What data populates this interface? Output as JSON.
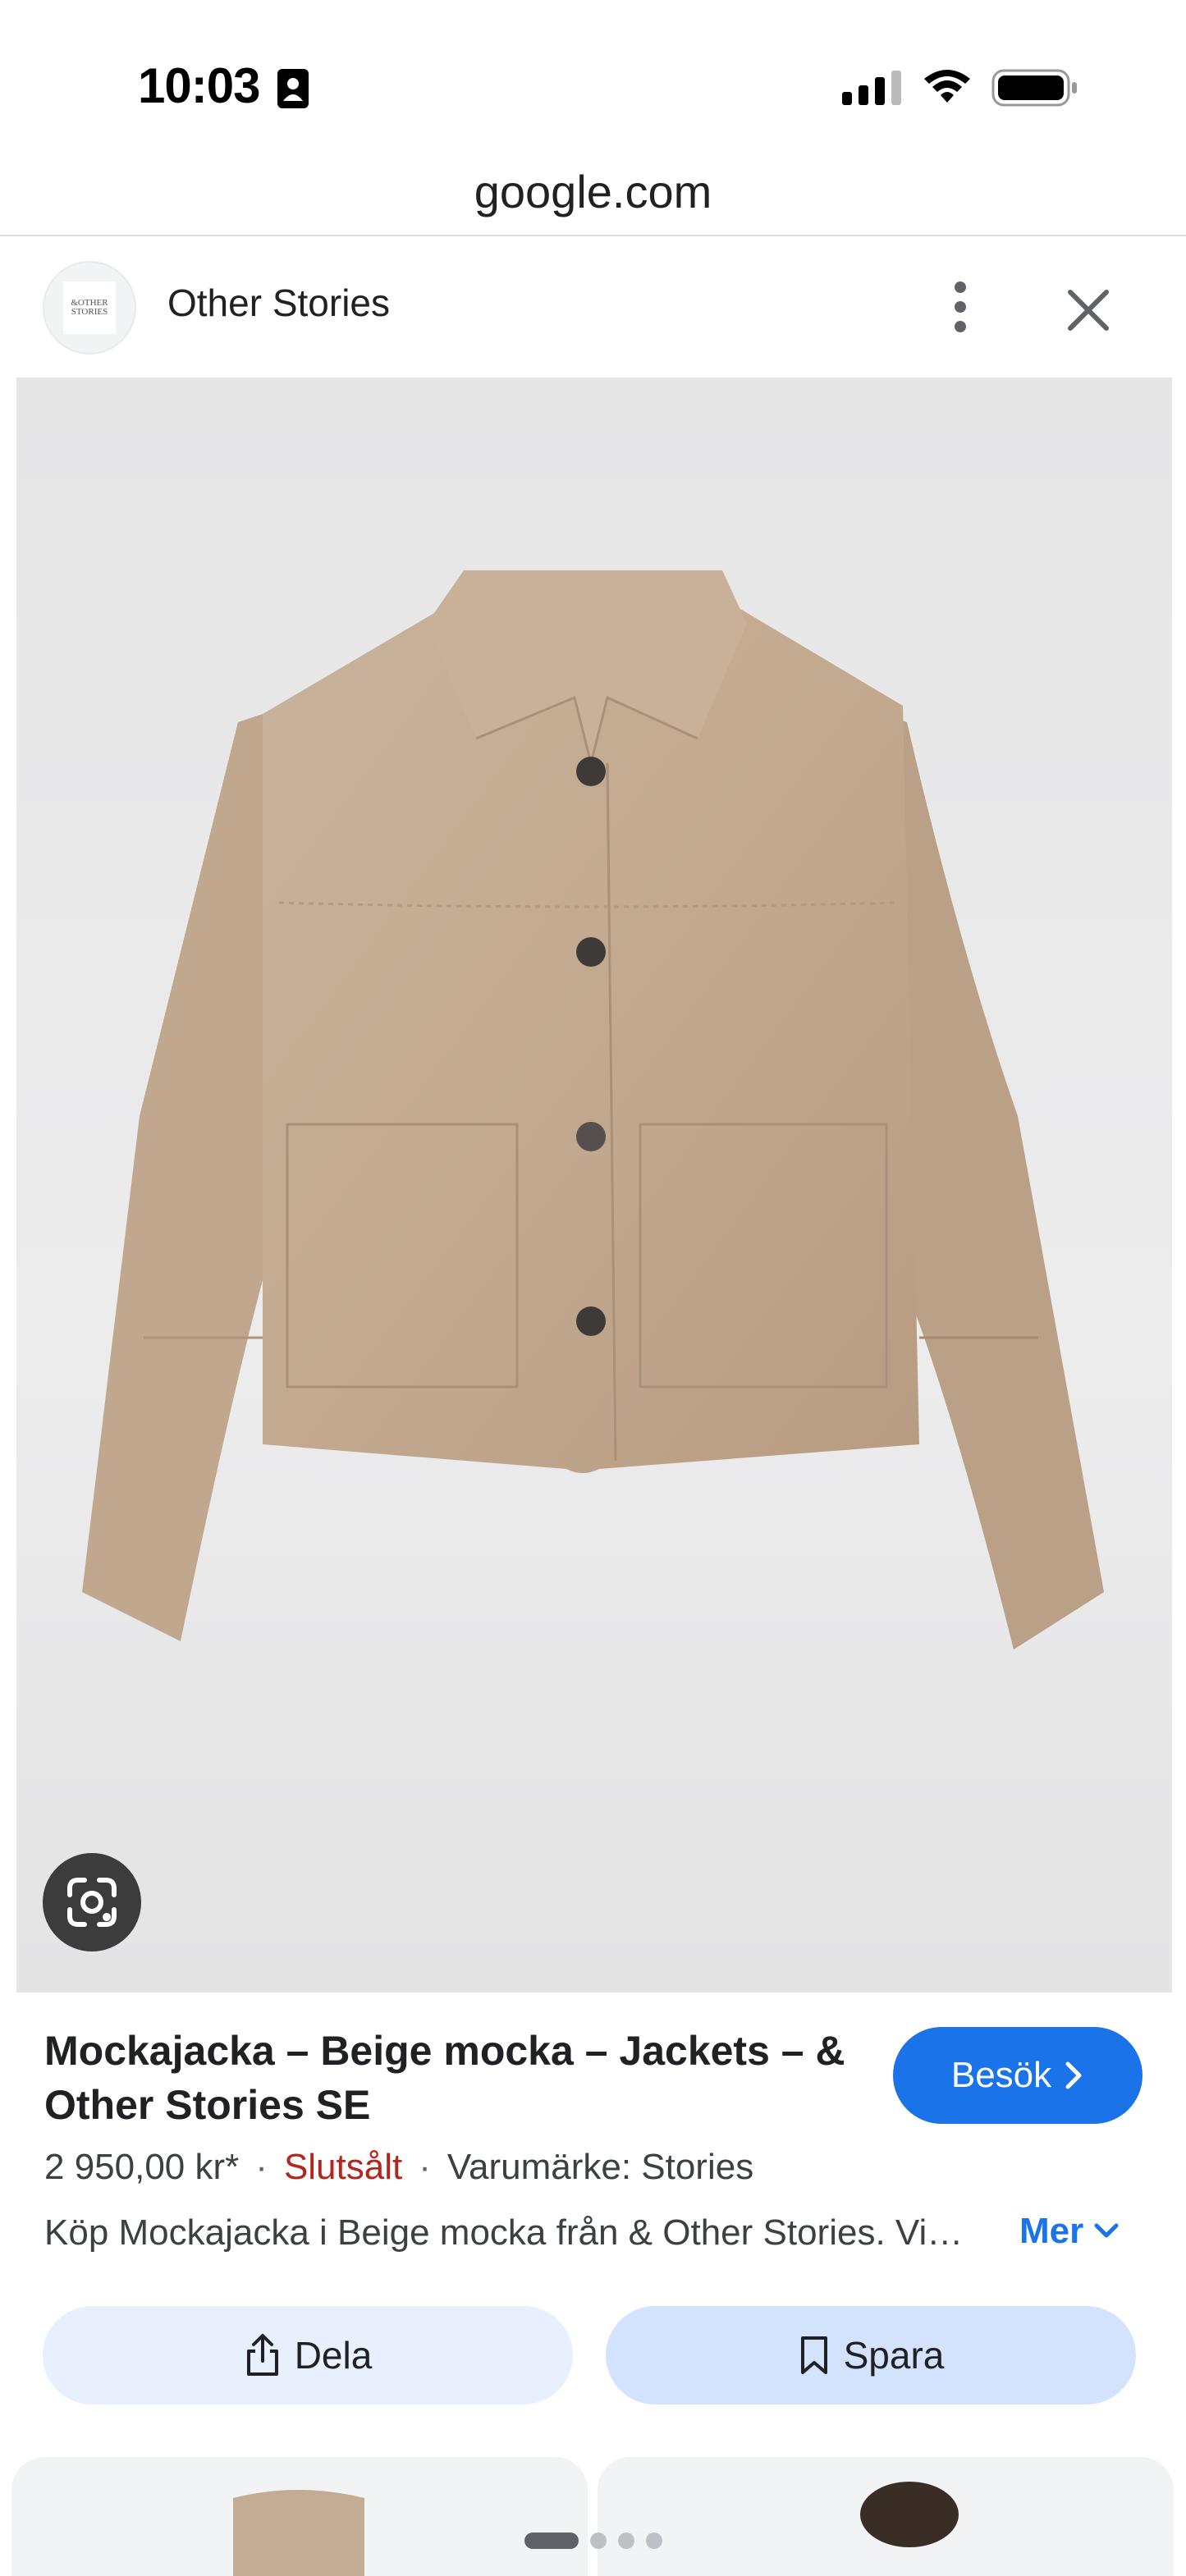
{
  "status_bar": {
    "time": "10:03",
    "icons": [
      "contact-card-icon",
      "cellular-signal-icon",
      "wifi-icon",
      "battery-icon"
    ]
  },
  "url_bar": {
    "domain": "google.com"
  },
  "site_header": {
    "site_name": "Other Stories",
    "logo_text": [
      "&OTHER",
      "STORIES"
    ],
    "icons": [
      "more-vert-icon",
      "close-icon"
    ]
  },
  "product_image": {
    "icons": [
      "google-lens-icon"
    ]
  },
  "product": {
    "title": "Mockajacka – Beige mocka – Jackets – & Other Stories SE",
    "visit_label": "Besök",
    "price": "2 950,00 kr*",
    "separator": "·",
    "stock_status": "Slutsålt",
    "brand": "Varumärke: Stories",
    "description": "Köp Mockajacka i Beige mocka från & Other Stories. Vi har ett brett utbud av jackor, rockar och mer.",
    "more_label": "Mer",
    "share_label": "Dela",
    "save_label": "Spara"
  },
  "colors": {
    "accent": "#1a73e8",
    "sold_out": "#b3261e",
    "share_bg": "#e8f0fe",
    "save_bg": "#d3e3fd",
    "jacket": "#c4ab93"
  },
  "page_indicator": {
    "total": 4,
    "active": 1
  }
}
